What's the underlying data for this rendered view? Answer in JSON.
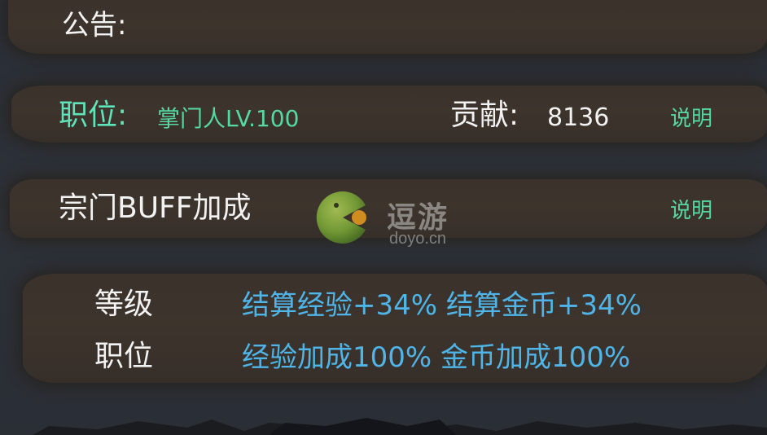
{
  "notice": {
    "label": "公告:"
  },
  "role": {
    "label": "职位:",
    "value": "掌门人LV.100"
  },
  "contribution": {
    "label": "贡献:",
    "value": "8136",
    "explain_label": "说明"
  },
  "buff": {
    "title": "宗门BUFF加成",
    "explain_label": "说明",
    "rows": [
      {
        "label": "等级",
        "value": "结算经验+34% 结算金币+34%"
      },
      {
        "label": "职位",
        "value": "经验加成100% 金币加成100%"
      }
    ]
  },
  "watermark": {
    "brand": "逗游",
    "domain": "doyo.cn",
    "icon": "pacman-logo-icon"
  },
  "colors": {
    "background": "#2b3038",
    "band": "#3a322b",
    "green_accent": "#5fe3b8",
    "blue_value": "#4fb5e8",
    "text": "#f2f2f2"
  }
}
